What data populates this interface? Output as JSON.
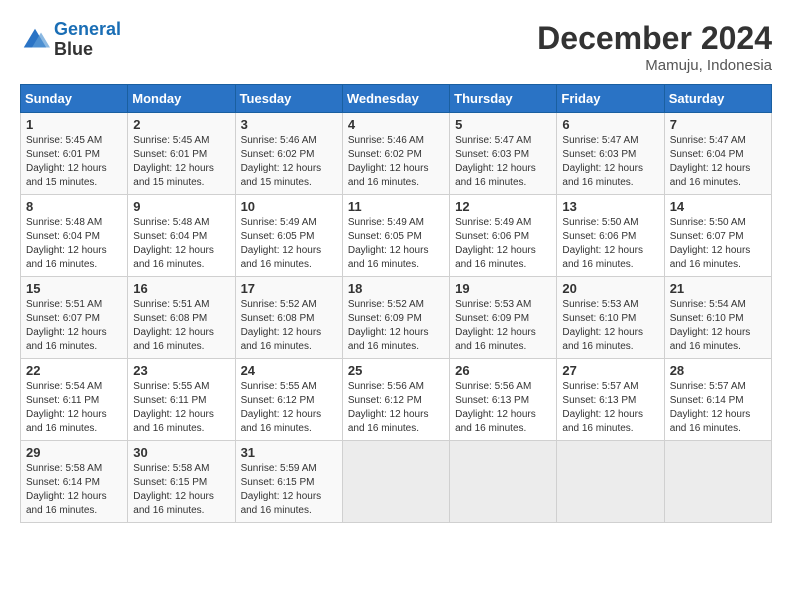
{
  "logo": {
    "line1": "General",
    "line2": "Blue"
  },
  "title": "December 2024",
  "location": "Mamuju, Indonesia",
  "days_of_week": [
    "Sunday",
    "Monday",
    "Tuesday",
    "Wednesday",
    "Thursday",
    "Friday",
    "Saturday"
  ],
  "weeks": [
    [
      {
        "day": 1,
        "sunrise": "5:45 AM",
        "sunset": "6:01 PM",
        "daylight": "12 hours and 15 minutes."
      },
      {
        "day": 2,
        "sunrise": "5:45 AM",
        "sunset": "6:01 PM",
        "daylight": "12 hours and 15 minutes."
      },
      {
        "day": 3,
        "sunrise": "5:46 AM",
        "sunset": "6:02 PM",
        "daylight": "12 hours and 15 minutes."
      },
      {
        "day": 4,
        "sunrise": "5:46 AM",
        "sunset": "6:02 PM",
        "daylight": "12 hours and 16 minutes."
      },
      {
        "day": 5,
        "sunrise": "5:47 AM",
        "sunset": "6:03 PM",
        "daylight": "12 hours and 16 minutes."
      },
      {
        "day": 6,
        "sunrise": "5:47 AM",
        "sunset": "6:03 PM",
        "daylight": "12 hours and 16 minutes."
      },
      {
        "day": 7,
        "sunrise": "5:47 AM",
        "sunset": "6:04 PM",
        "daylight": "12 hours and 16 minutes."
      }
    ],
    [
      {
        "day": 8,
        "sunrise": "5:48 AM",
        "sunset": "6:04 PM",
        "daylight": "12 hours and 16 minutes."
      },
      {
        "day": 9,
        "sunrise": "5:48 AM",
        "sunset": "6:04 PM",
        "daylight": "12 hours and 16 minutes."
      },
      {
        "day": 10,
        "sunrise": "5:49 AM",
        "sunset": "6:05 PM",
        "daylight": "12 hours and 16 minutes."
      },
      {
        "day": 11,
        "sunrise": "5:49 AM",
        "sunset": "6:05 PM",
        "daylight": "12 hours and 16 minutes."
      },
      {
        "day": 12,
        "sunrise": "5:49 AM",
        "sunset": "6:06 PM",
        "daylight": "12 hours and 16 minutes."
      },
      {
        "day": 13,
        "sunrise": "5:50 AM",
        "sunset": "6:06 PM",
        "daylight": "12 hours and 16 minutes."
      },
      {
        "day": 14,
        "sunrise": "5:50 AM",
        "sunset": "6:07 PM",
        "daylight": "12 hours and 16 minutes."
      }
    ],
    [
      {
        "day": 15,
        "sunrise": "5:51 AM",
        "sunset": "6:07 PM",
        "daylight": "12 hours and 16 minutes."
      },
      {
        "day": 16,
        "sunrise": "5:51 AM",
        "sunset": "6:08 PM",
        "daylight": "12 hours and 16 minutes."
      },
      {
        "day": 17,
        "sunrise": "5:52 AM",
        "sunset": "6:08 PM",
        "daylight": "12 hours and 16 minutes."
      },
      {
        "day": 18,
        "sunrise": "5:52 AM",
        "sunset": "6:09 PM",
        "daylight": "12 hours and 16 minutes."
      },
      {
        "day": 19,
        "sunrise": "5:53 AM",
        "sunset": "6:09 PM",
        "daylight": "12 hours and 16 minutes."
      },
      {
        "day": 20,
        "sunrise": "5:53 AM",
        "sunset": "6:10 PM",
        "daylight": "12 hours and 16 minutes."
      },
      {
        "day": 21,
        "sunrise": "5:54 AM",
        "sunset": "6:10 PM",
        "daylight": "12 hours and 16 minutes."
      }
    ],
    [
      {
        "day": 22,
        "sunrise": "5:54 AM",
        "sunset": "6:11 PM",
        "daylight": "12 hours and 16 minutes."
      },
      {
        "day": 23,
        "sunrise": "5:55 AM",
        "sunset": "6:11 PM",
        "daylight": "12 hours and 16 minutes."
      },
      {
        "day": 24,
        "sunrise": "5:55 AM",
        "sunset": "6:12 PM",
        "daylight": "12 hours and 16 minutes."
      },
      {
        "day": 25,
        "sunrise": "5:56 AM",
        "sunset": "6:12 PM",
        "daylight": "12 hours and 16 minutes."
      },
      {
        "day": 26,
        "sunrise": "5:56 AM",
        "sunset": "6:13 PM",
        "daylight": "12 hours and 16 minutes."
      },
      {
        "day": 27,
        "sunrise": "5:57 AM",
        "sunset": "6:13 PM",
        "daylight": "12 hours and 16 minutes."
      },
      {
        "day": 28,
        "sunrise": "5:57 AM",
        "sunset": "6:14 PM",
        "daylight": "12 hours and 16 minutes."
      }
    ],
    [
      {
        "day": 29,
        "sunrise": "5:58 AM",
        "sunset": "6:14 PM",
        "daylight": "12 hours and 16 minutes."
      },
      {
        "day": 30,
        "sunrise": "5:58 AM",
        "sunset": "6:15 PM",
        "daylight": "12 hours and 16 minutes."
      },
      {
        "day": 31,
        "sunrise": "5:59 AM",
        "sunset": "6:15 PM",
        "daylight": "12 hours and 16 minutes."
      },
      null,
      null,
      null,
      null
    ]
  ]
}
